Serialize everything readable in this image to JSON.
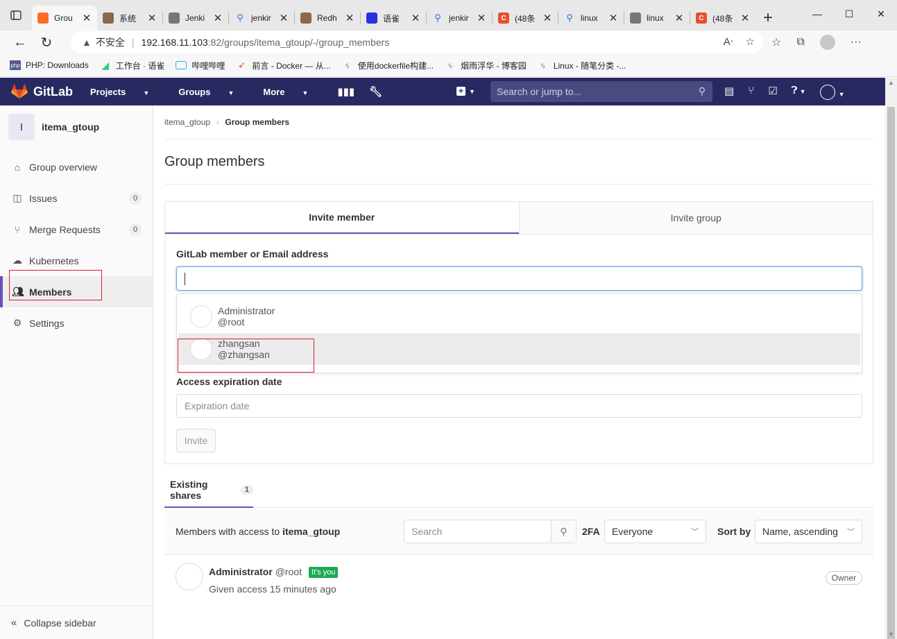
{
  "browser": {
    "tabs": [
      {
        "title": "Grou",
        "favicon_color": "#fc6d26",
        "active": true
      },
      {
        "title": "系统",
        "favicon_color": "#8a6a4a"
      },
      {
        "title": "Jenki",
        "favicon_color": "#666666"
      },
      {
        "title": "jenkir",
        "favicon_color": "#1a73e8"
      },
      {
        "title": "Redh",
        "favicon_color": "#8a6a4a"
      },
      {
        "title": "语雀",
        "favicon_color": "#2932e1"
      },
      {
        "title": "jenkir",
        "favicon_color": "#1a73e8"
      },
      {
        "title": "(48条",
        "favicon_color": "#e6502f"
      },
      {
        "title": "linux",
        "favicon_color": "#1a73e8"
      },
      {
        "title": "linux",
        "favicon_color": "#666666"
      },
      {
        "title": "(48条",
        "favicon_color": "#e6502f"
      }
    ],
    "address": {
      "security_label": "不安全",
      "host": "192.168.11.103",
      "path": ":82/groups/itema_gtoup/-/group_members"
    },
    "bookmarks": [
      {
        "label": "PHP: Downloads",
        "icon": "php-icon"
      },
      {
        "label": "工作台 · 语雀",
        "icon": "yuque-icon"
      },
      {
        "label": "哔哩哔哩",
        "icon": "bilibili-icon"
      },
      {
        "label": "前言 - Docker — 从...",
        "icon": "rocket-icon"
      },
      {
        "label": "使用dockerfile构建...",
        "icon": "cnblogs-icon"
      },
      {
        "label": "烟雨浮华 - 博客园",
        "icon": "cnblogs-icon"
      },
      {
        "label": "Linux - 随笔分类 -...",
        "icon": "cnblogs-icon"
      }
    ]
  },
  "gitlab": {
    "brand": "GitLab",
    "nav": [
      "Projects",
      "Groups",
      "More"
    ],
    "search_placeholder": "Search or jump to...",
    "accent": "#292961"
  },
  "sidebar": {
    "group_letter": "I",
    "group_name": "itema_gtoup",
    "items": [
      {
        "label": "Group overview",
        "icon": "home-icon"
      },
      {
        "label": "Issues",
        "icon": "issues-icon",
        "count": "0"
      },
      {
        "label": "Merge Requests",
        "icon": "merge-request-icon",
        "count": "0"
      },
      {
        "label": "Kubernetes",
        "icon": "kubernetes-icon"
      },
      {
        "label": "Members",
        "icon": "members-icon",
        "active": true
      },
      {
        "label": "Settings",
        "icon": "gear-icon"
      }
    ],
    "collapse_label": "Collapse sidebar"
  },
  "breadcrumb": {
    "parent": "itema_gtoup",
    "current": "Group members"
  },
  "page_title": "Group members",
  "invite": {
    "tabs": [
      "Invite member",
      "Invite group"
    ],
    "member_label": "GitLab member or Email address",
    "suggestions": [
      {
        "name": "Administrator",
        "username": "@root"
      },
      {
        "name": "zhangsan",
        "username": "@zhangsan",
        "highlighted": true
      }
    ],
    "expiration_label": "Access expiration date",
    "expiration_placeholder": "Expiration date",
    "invite_button": "Invite"
  },
  "shares": {
    "tab_label": "Existing shares",
    "tab_count": "1",
    "members_prefix": "Members with access to",
    "group_name": "itema_gtoup",
    "search_placeholder": "Search",
    "twofa_label": "2FA",
    "twofa_value": "Everyone",
    "sort_label": "Sort by",
    "sort_value": "Name, ascending"
  },
  "members": [
    {
      "name": "Administrator",
      "username": "@root",
      "badge": "It's you",
      "access": "Given access 15 minutes ago",
      "role": "Owner"
    }
  ],
  "annotation_color": "#d4202a"
}
